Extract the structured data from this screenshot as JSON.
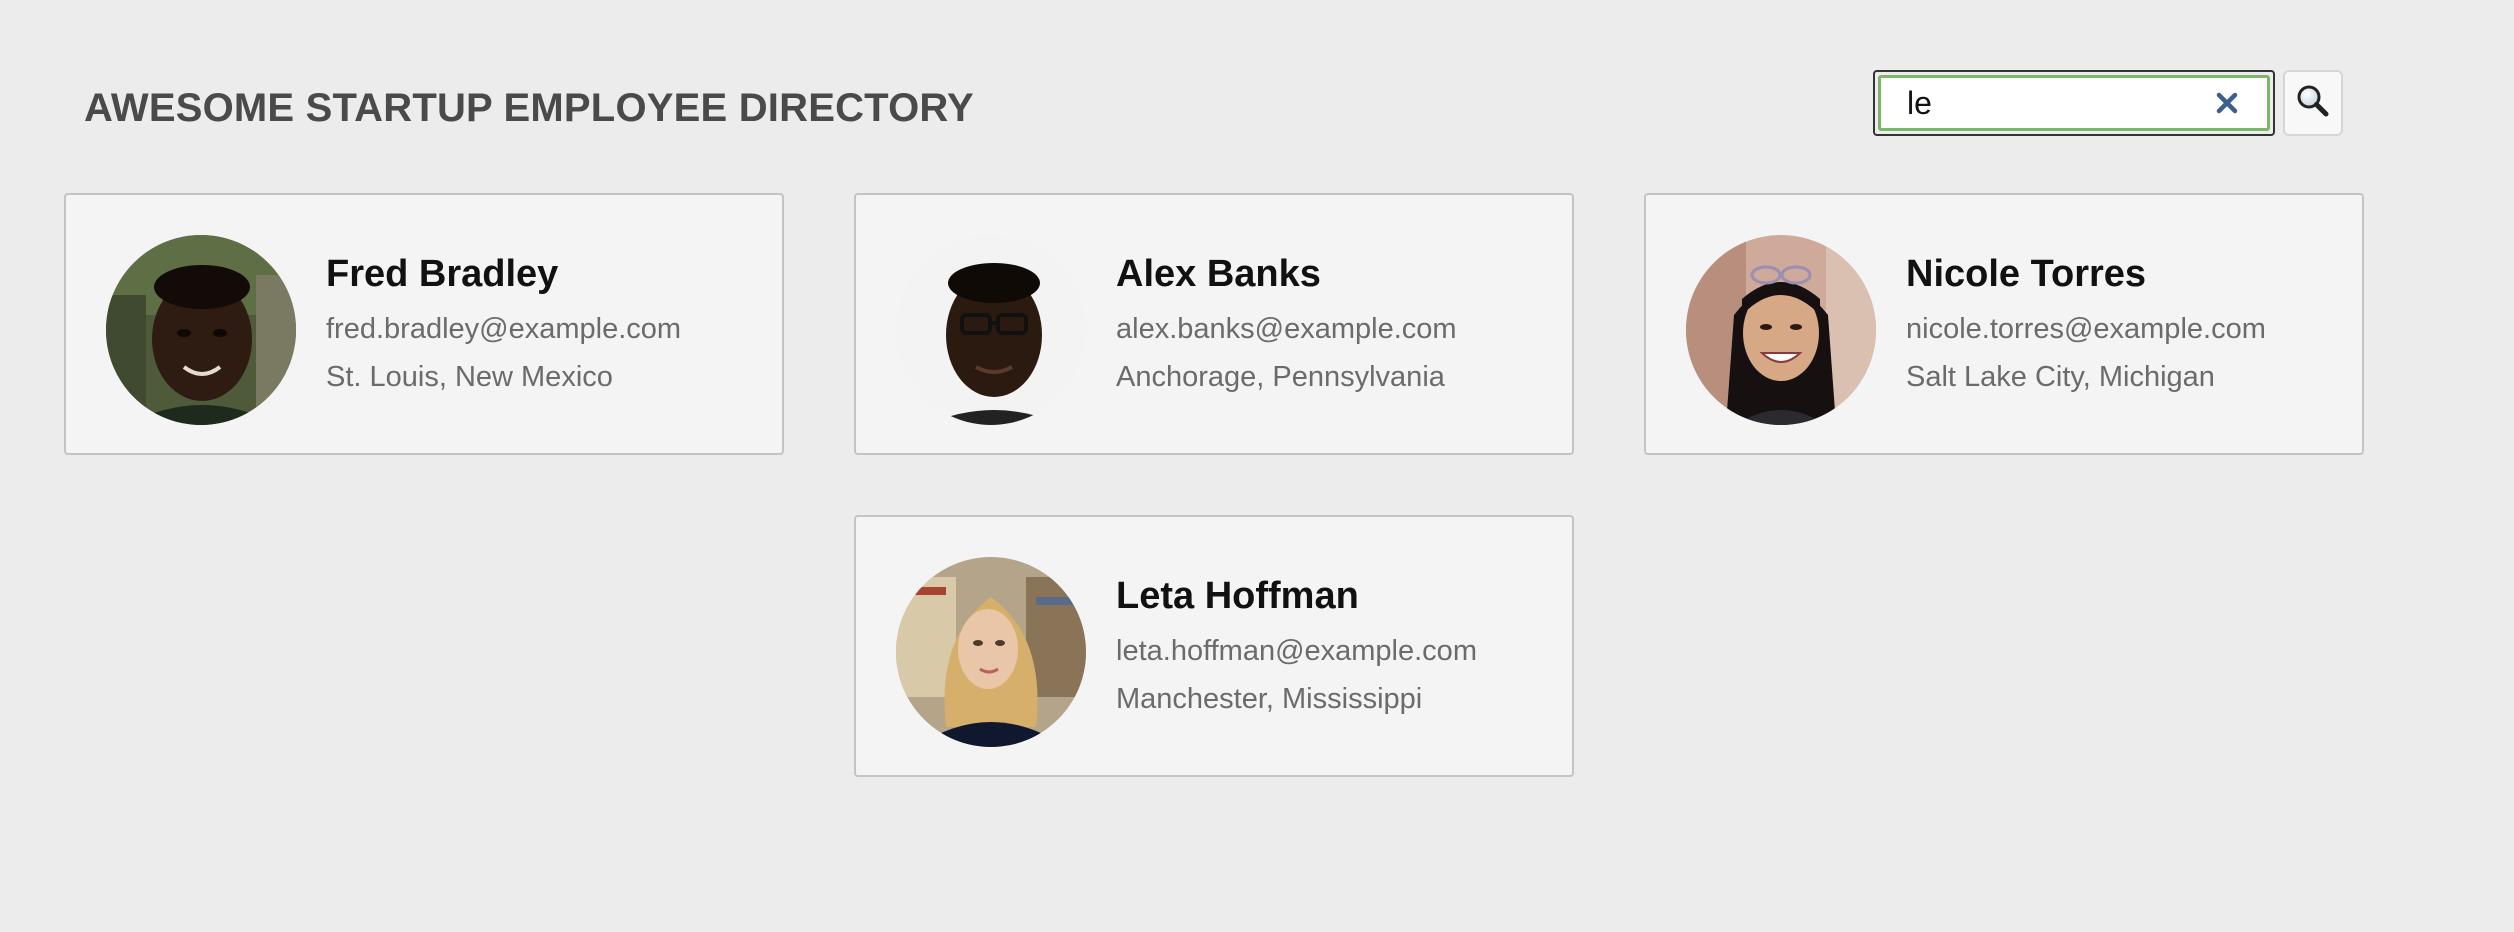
{
  "header": {
    "title": "AWESOME STARTUP EMPLOYEE DIRECTORY"
  },
  "search": {
    "value": "le",
    "placeholder": "",
    "clear_icon": "close-icon",
    "button_icon": "search-icon"
  },
  "colors": {
    "background": "#ececec",
    "card_background": "#f4f4f4",
    "card_border": "#c4c4c4",
    "search_focus_border": "#7fb56a",
    "clear_icon": "#3d5f8c",
    "title": "#4a4a4a"
  },
  "employees": [
    {
      "name": "Fred Bradley",
      "email": "fred.bradley@example.com",
      "location": "St. Louis, New Mexico"
    },
    {
      "name": "Alex Banks",
      "email": "alex.banks@example.com",
      "location": "Anchorage, Pennsylvania"
    },
    {
      "name": "Nicole Torres",
      "email": "nicole.torres@example.com",
      "location": "Salt Lake City, Michigan"
    },
    {
      "name": "Leta Hoffman",
      "email": "leta.hoffman@example.com",
      "location": "Manchester, Mississippi"
    }
  ]
}
